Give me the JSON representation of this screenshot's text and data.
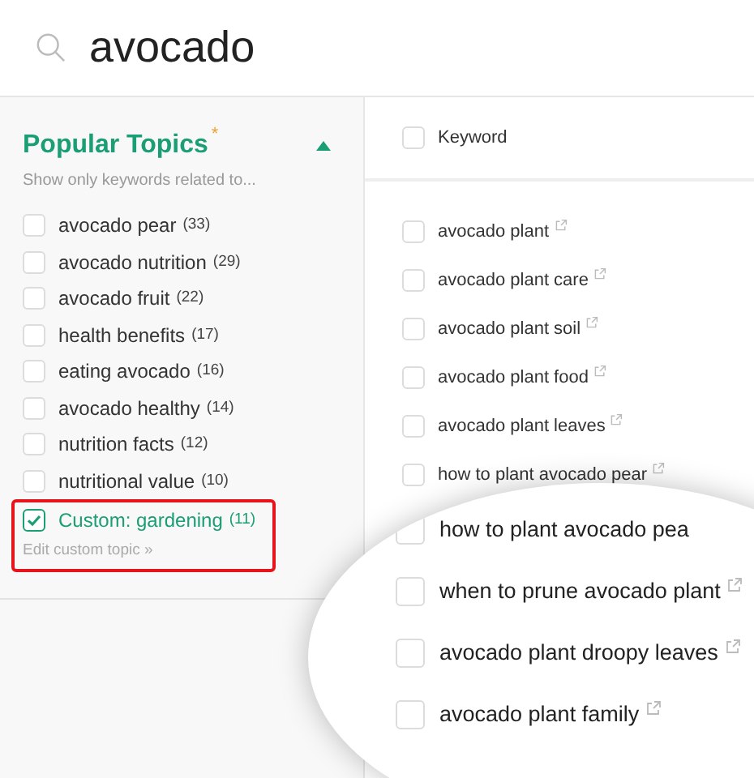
{
  "search": {
    "value": "avocado"
  },
  "sidebar": {
    "title": "Popular Topics",
    "required_mark": "*",
    "subtitle": "Show only keywords related to...",
    "expanded": true,
    "topics": [
      {
        "kind": "topic",
        "label": "avocado pear",
        "count": "(33)",
        "checked": false,
        "highlighted": false
      },
      {
        "kind": "topic",
        "label": "avocado nutrition",
        "count": "(29)",
        "checked": false,
        "highlighted": false
      },
      {
        "kind": "topic",
        "label": "avocado fruit",
        "count": "(22)",
        "checked": false,
        "highlighted": false
      },
      {
        "kind": "topic",
        "label": "health benefits",
        "count": "(17)",
        "checked": false,
        "highlighted": false
      },
      {
        "kind": "topic",
        "label": "eating avocado",
        "count": "(16)",
        "checked": false,
        "highlighted": false
      },
      {
        "kind": "topic",
        "label": "avocado healthy",
        "count": "(14)",
        "checked": false,
        "highlighted": false
      },
      {
        "kind": "topic",
        "label": "nutrition facts",
        "count": "(12)",
        "checked": false,
        "highlighted": false
      },
      {
        "kind": "topic",
        "label": "nutritional value",
        "count": "(10)",
        "checked": false,
        "highlighted": false
      },
      {
        "kind": "custom",
        "label": "Custom: gardening",
        "count": "(11)",
        "checked": true,
        "highlighted": true,
        "link": "Edit custom topic »"
      }
    ]
  },
  "table": {
    "header": {
      "label": "Keyword",
      "checked": false
    },
    "rows": [
      {
        "keyword": "avocado plant",
        "checked": false
      },
      {
        "keyword": "avocado plant care",
        "checked": false
      },
      {
        "keyword": "avocado plant soil",
        "checked": false
      },
      {
        "keyword": "avocado plant food",
        "checked": false
      },
      {
        "keyword": "avocado plant leaves",
        "checked": false
      },
      {
        "keyword": "how to plant avocado pear",
        "checked": false
      }
    ]
  },
  "magnifier": {
    "rows": [
      {
        "keyword": "how to plant avocado pea",
        "checked": false,
        "link_icon": false
      },
      {
        "keyword": "when to prune avocado plant",
        "checked": false,
        "link_icon": true
      },
      {
        "keyword": "avocado plant droopy leaves",
        "checked": false,
        "link_icon": true
      },
      {
        "keyword": "avocado plant family",
        "checked": false,
        "link_icon": true
      }
    ]
  }
}
